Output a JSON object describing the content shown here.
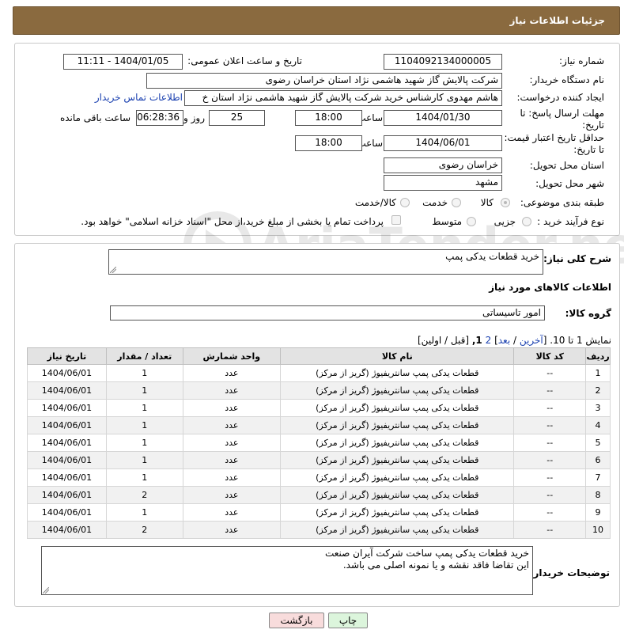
{
  "header": {
    "title": "جزئیات اطلاعات نیاز"
  },
  "form": {
    "need_number_label": "شماره نیاز:",
    "need_number": "1104092134000005",
    "announce_label": "تاریخ و ساعت اعلان عمومی:",
    "announce_value": "1404/01/05 - 11:11",
    "buyer_org_label": "نام دستگاه خریدار:",
    "buyer_org": "شرکت پالایش گاز شهید هاشمی نژاد   استان خراسان رضوی",
    "creator_label": "ایجاد کننده درخواست:",
    "creator": "هاشم مهدوی کارشناس خرید شرکت پالایش گاز شهید هاشمی نژاد   استان خ",
    "contact_link": "اطلاعات تماس خریدار",
    "deadline_label": "مهلت ارسال پاسخ: تا تاریخ:",
    "deadline_date": "1404/01/30",
    "time_label": "ساعت",
    "deadline_time": "18:00",
    "days_value": "25",
    "days_label": "روز و",
    "remaining_time": "06:28:36",
    "remaining_label": "ساعت باقی مانده",
    "validity_label": "حداقل تاریخ اعتبار قیمت: تا تاریخ:",
    "validity_date": "1404/06/01",
    "validity_time": "18:00",
    "province_label": "استان محل تحویل:",
    "province": "خراسان رضوی",
    "city_label": "شهر محل تحویل:",
    "city": "مشهد",
    "category_label": "طبقه بندی موضوعی:",
    "category_options": [
      "کالا",
      "خدمت",
      "کالا/خدمت"
    ],
    "process_label": "نوع فرآیند خرید :",
    "process_options": [
      "جزیی",
      "متوسط"
    ],
    "payment_note": "پرداخت تمام یا بخشی از مبلغ خرید،از محل \"اسناد خزانه اسلامی\" خواهد بود."
  },
  "details": {
    "summary_label": "شرح کلی نیاز:",
    "summary": "خرید قطعات یدکی پمپ",
    "goods_title": "اطلاعات کالاهای مورد نیاز",
    "group_label": "گروه کالا:",
    "group": "امور تاسیساتی",
    "pager_text": "نمایش 1 تا 10.",
    "pager_last": "آخرین",
    "pager_next": "بعد",
    "pager_page2": "2",
    "pager_current": "1,",
    "pager_prev": "[قبل / اولین]",
    "columns": [
      "ردیف",
      "کد کالا",
      "نام کالا",
      "واحد شمارش",
      "تعداد / مقدار",
      "تاریخ نیاز"
    ],
    "rows": [
      [
        "1",
        "--",
        "قطعات یدکی پمپ سانتریفیوژ (گریز از مرکز)",
        "عدد",
        "1",
        "1404/06/01"
      ],
      [
        "2",
        "--",
        "قطعات یدکی پمپ سانتریفیوژ (گریز از مرکز)",
        "عدد",
        "1",
        "1404/06/01"
      ],
      [
        "3",
        "--",
        "قطعات یدکی پمپ سانتریفیوژ (گریز از مرکز)",
        "عدد",
        "1",
        "1404/06/01"
      ],
      [
        "4",
        "--",
        "قطعات یدکی پمپ سانتریفیوژ (گریز از مرکز)",
        "عدد",
        "1",
        "1404/06/01"
      ],
      [
        "5",
        "--",
        "قطعات یدکی پمپ سانتریفیوژ (گریز از مرکز)",
        "عدد",
        "1",
        "1404/06/01"
      ],
      [
        "6",
        "--",
        "قطعات یدکی پمپ سانتریفیوژ (گریز از مرکز)",
        "عدد",
        "1",
        "1404/06/01"
      ],
      [
        "7",
        "--",
        "قطعات یدکی پمپ سانتریفیوژ (گریز از مرکز)",
        "عدد",
        "1",
        "1404/06/01"
      ],
      [
        "8",
        "--",
        "قطعات یدکی پمپ سانتریفیوژ (گریز از مرکز)",
        "عدد",
        "2",
        "1404/06/01"
      ],
      [
        "9",
        "--",
        "قطعات یدکی پمپ سانتریفیوژ (گریز از مرکز)",
        "عدد",
        "1",
        "1404/06/01"
      ],
      [
        "10",
        "--",
        "قطعات یدکی پمپ سانتریفیوژ (گریز از مرکز)",
        "عدد",
        "2",
        "1404/06/01"
      ]
    ],
    "buyer_notes_label": "توضیحات خریدار:",
    "buyer_notes_line1": "خرید قطعات یدکی پمپ ساخت شرکت آیران صنعت",
    "buyer_notes_line2": "این تقاضا فاقد نقشه و یا نمونه اصلی می باشد."
  },
  "buttons": {
    "print": "چاپ",
    "back": "بازگشت"
  },
  "watermark": {
    "text": "AriaTender.net"
  },
  "colors": {
    "header_bg": "#8a6a3f",
    "link": "#1a40b0",
    "back_button_bg": "#f8dcdc",
    "print_button_bg": "#dcf5dc"
  }
}
